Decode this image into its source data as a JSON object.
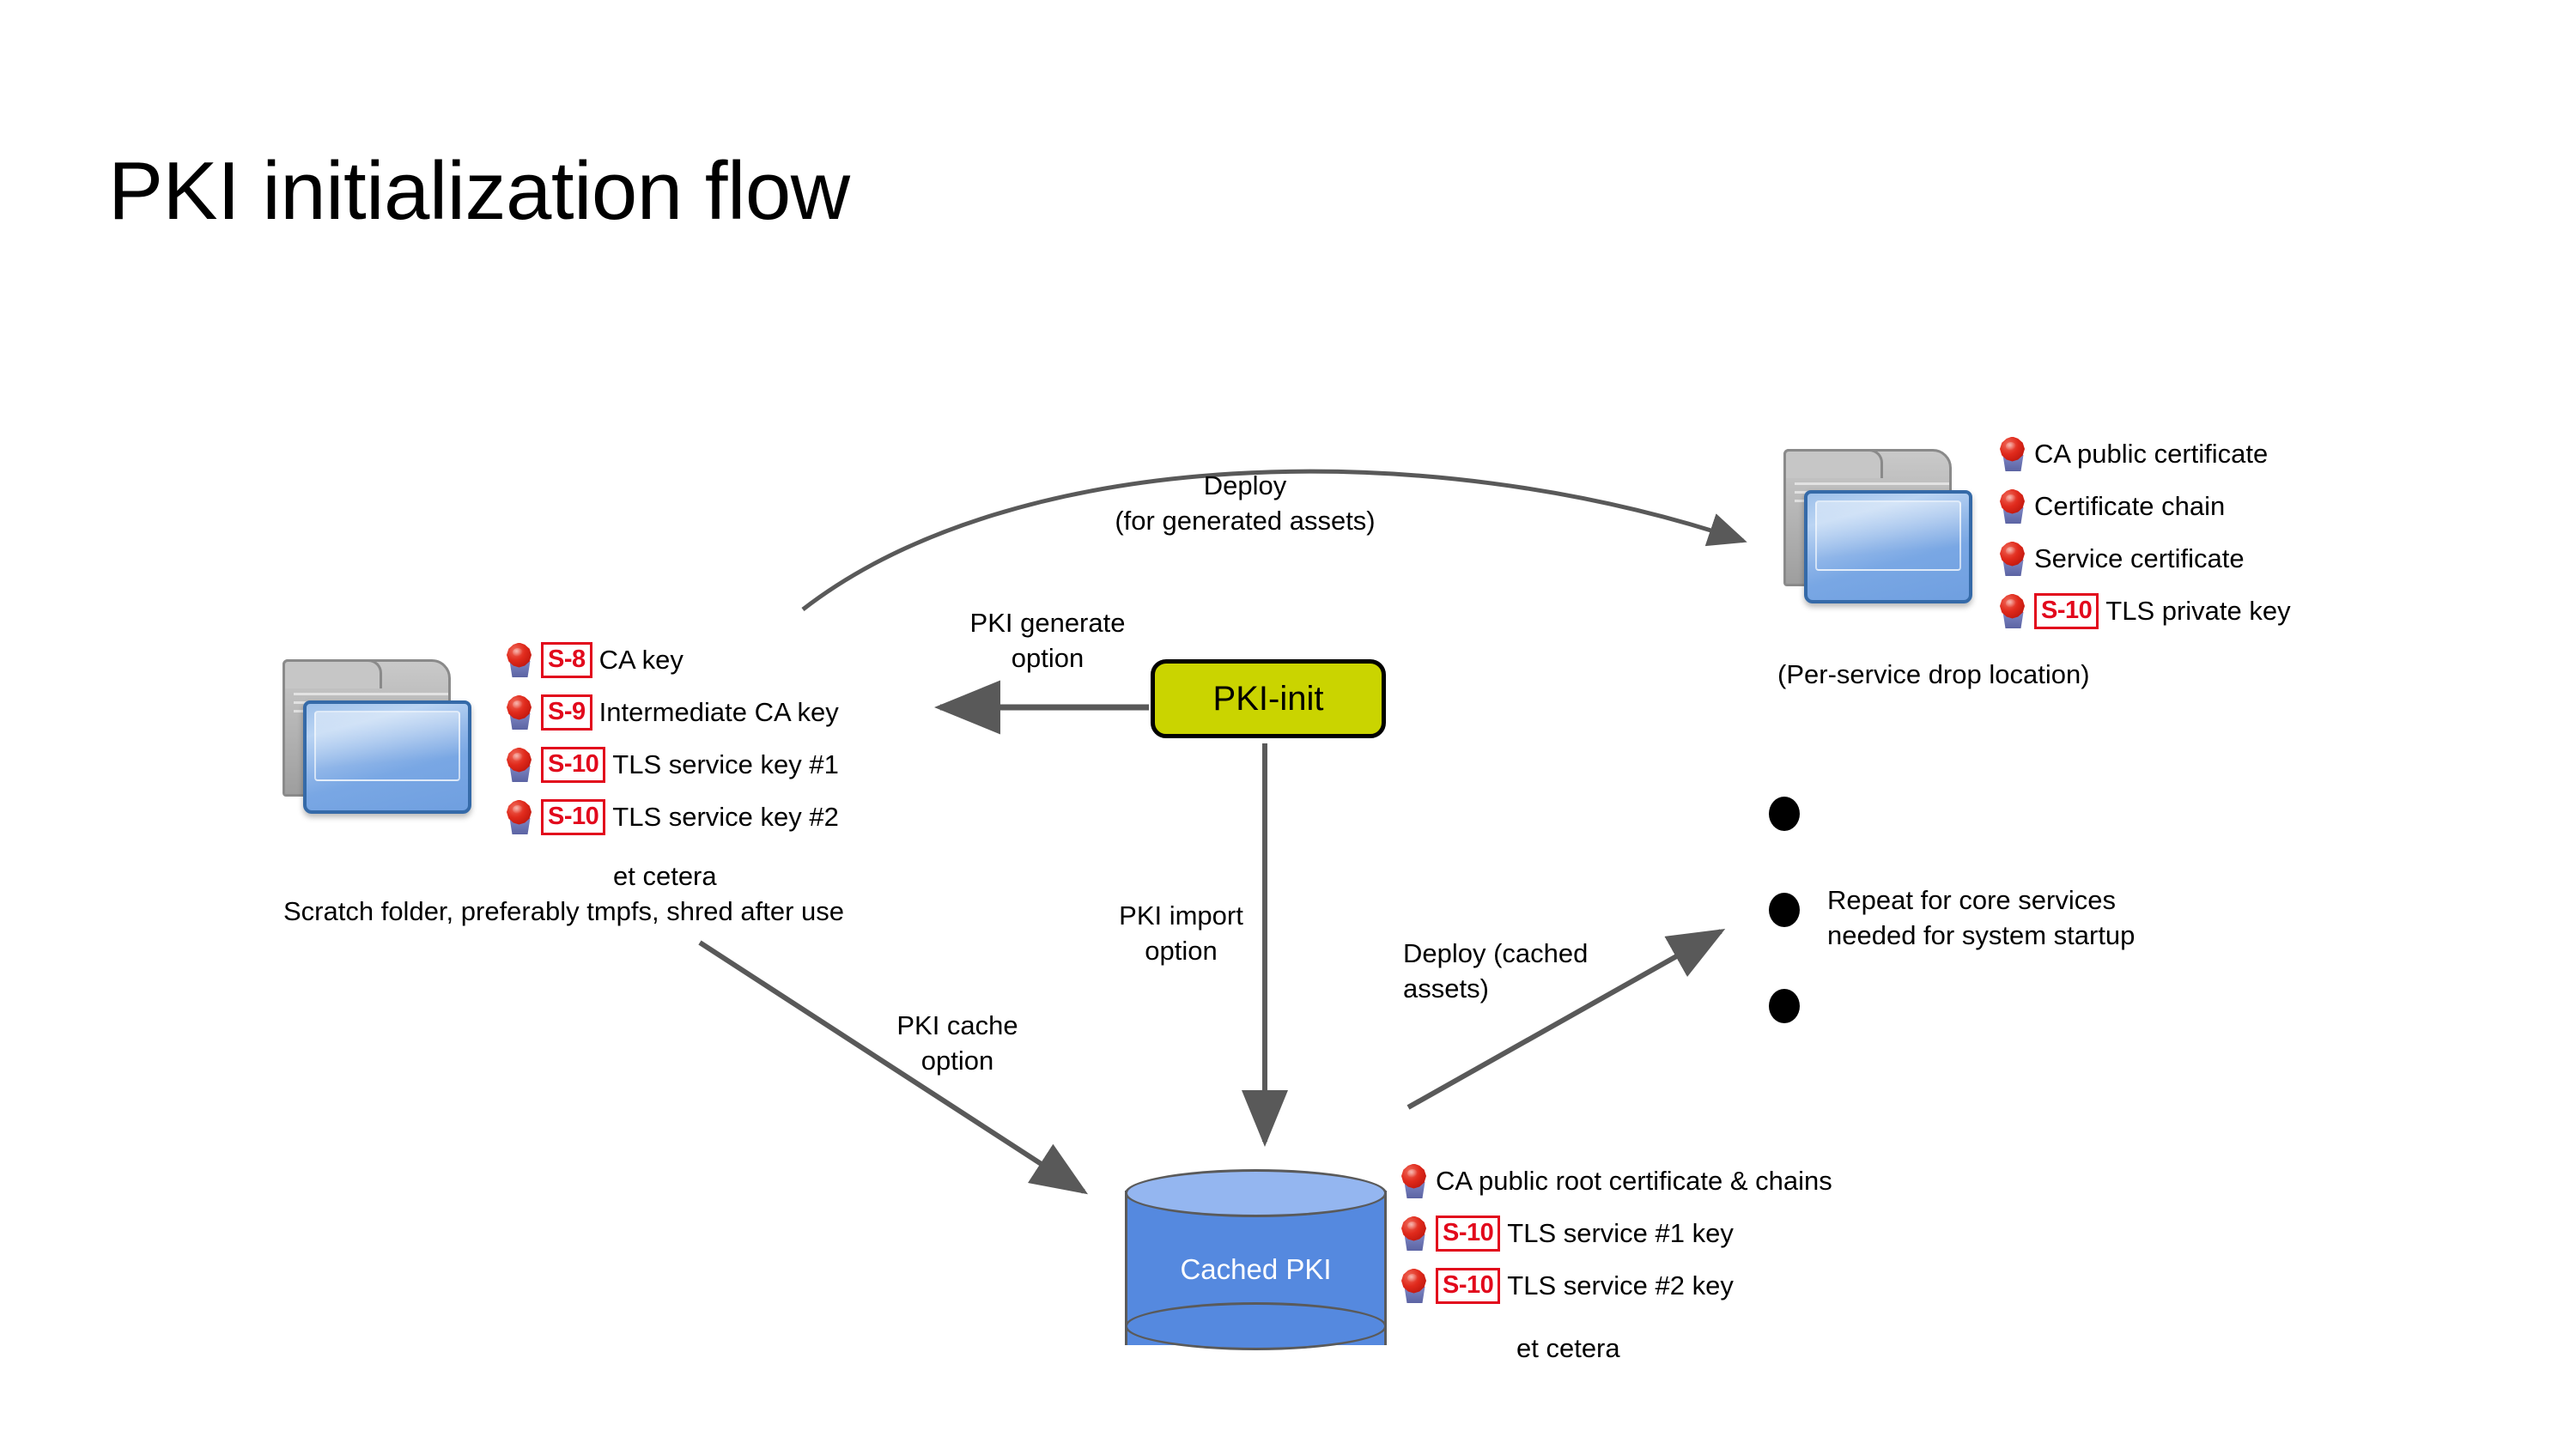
{
  "slide": {
    "title": "PKI initialization flow"
  },
  "nodes": {
    "pki_init": {
      "label": "PKI-init"
    },
    "cache": {
      "label": "Cached PKI"
    }
  },
  "scratch_folder": {
    "caption_line1": "et cetera",
    "caption_line2": "Scratch folder, preferably tmpfs, shred after use",
    "assets": [
      {
        "badge": "S-8",
        "label": "CA key"
      },
      {
        "badge": "S-9",
        "label": "Intermediate  CA key"
      },
      {
        "badge": "S-10",
        "label": "TLS service  key #1"
      },
      {
        "badge": "S-10",
        "label": "TLS service  key #2"
      }
    ]
  },
  "drop_folder": {
    "caption": "(Per-service drop location)",
    "assets": [
      {
        "badge": "",
        "label": "CA public certificate"
      },
      {
        "badge": "",
        "label": "Certificate chain"
      },
      {
        "badge": "",
        "label": "Service  certificate"
      },
      {
        "badge": "S-10",
        "label": "TLS private  key"
      }
    ]
  },
  "cached_pki": {
    "caption": "et cetera",
    "assets": [
      {
        "badge": "",
        "label": "CA public root certificate & chains"
      },
      {
        "badge": "S-10",
        "label": "TLS service #1 key"
      },
      {
        "badge": "S-10",
        "label": "TLS service #2 key"
      }
    ]
  },
  "edges": {
    "deploy_generated": {
      "line1": "Deploy",
      "line2": "(for generated assets)"
    },
    "pki_generate": {
      "line1": "PKI generate",
      "line2": "option"
    },
    "pki_import": {
      "line1": "PKI import",
      "line2": "option"
    },
    "pki_cache": {
      "line1": "PKI cache",
      "line2": "option"
    },
    "deploy_cached": {
      "line1": "Deploy (cached",
      "line2": "assets)"
    }
  },
  "repeat_note": {
    "line1": "Repeat for core services",
    "line2": "needed for system startup"
  },
  "colors": {
    "pki_init_fill": "#cad400",
    "pki_init_stroke": "#000000",
    "cylinder_body": "#5589df",
    "cylinder_top": "#94b6f0",
    "badge_red": "#e2081c",
    "arrow_gray": "#595959",
    "folder_blue": "#79a7e4",
    "folder_gray": "#b2b2b2"
  }
}
